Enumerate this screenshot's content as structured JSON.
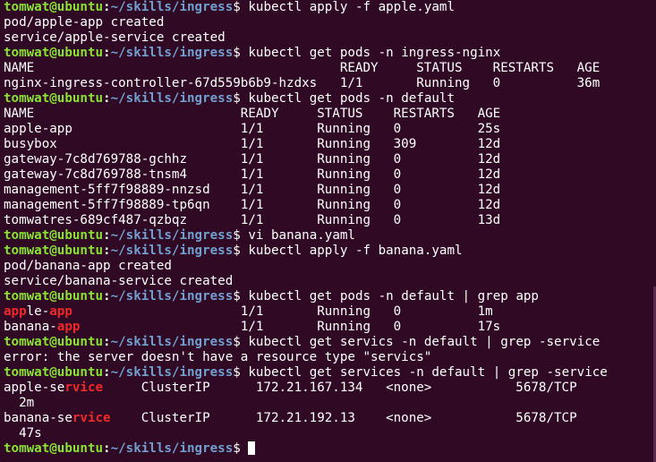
{
  "prompt": {
    "user": "tomwat@ubuntu",
    "sep": ":",
    "path": "~/skills/ingress",
    "dollar": "$ "
  },
  "lines": [
    {
      "type": "prompt",
      "cmd": "kubectl apply -f apple.yaml"
    },
    {
      "type": "out",
      "text": "pod/apple-app created"
    },
    {
      "type": "out",
      "text": "service/apple-service created"
    },
    {
      "type": "prompt",
      "cmd": "kubectl get pods -n ingress-nginx"
    },
    {
      "type": "out",
      "text": "NAME                                        READY     STATUS    RESTARTS   AGE"
    },
    {
      "type": "out",
      "text": "nginx-ingress-controller-67d559b6b9-hzdxs   1/1       Running   0          36m"
    },
    {
      "type": "prompt",
      "cmd": "kubectl get pods -n default"
    },
    {
      "type": "out",
      "text": "NAME                           READY     STATUS    RESTARTS   AGE"
    },
    {
      "type": "out",
      "text": "apple-app                      1/1       Running   0          25s"
    },
    {
      "type": "out",
      "text": "busybox                        1/1       Running   309        12d"
    },
    {
      "type": "out",
      "text": "gateway-7c8d769788-gchhz       1/1       Running   0          12d"
    },
    {
      "type": "out",
      "text": "gateway-7c8d769788-tnsm4       1/1       Running   0          12d"
    },
    {
      "type": "out",
      "text": "management-5ff7f98889-nnzsd    1/1       Running   0          12d"
    },
    {
      "type": "out",
      "text": "management-5ff7f98889-tp6qn    1/1       Running   0          12d"
    },
    {
      "type": "out",
      "text": "tomwatres-689cf487-qzbqz       1/1       Running   0          13d"
    },
    {
      "type": "prompt",
      "cmd": "vi banana.yaml"
    },
    {
      "type": "prompt",
      "cmd": "kubectl apply -f banana.yaml"
    },
    {
      "type": "out",
      "text": "pod/banana-app created"
    },
    {
      "type": "out",
      "text": "service/banana-service created"
    },
    {
      "type": "prompt",
      "cmd": "kubectl get pods -n default | grep app"
    },
    {
      "type": "hl",
      "pre": "",
      "hl": "app",
      "post": "le-",
      "hl2": "app",
      "rest": "                      1/1       Running   0          1m"
    },
    {
      "type": "hl",
      "pre": "banana-",
      "hl": "app",
      "post": "",
      "hl2": "",
      "rest": "                     1/1       Running   0          17s"
    },
    {
      "type": "prompt",
      "cmd": "kubectl get servics -n default | grep -service"
    },
    {
      "type": "out",
      "text": "error: the server doesn't have a resource type \"servics\""
    },
    {
      "type": "prompt",
      "cmd": "kubectl get services -n default | grep -service"
    },
    {
      "type": "hl",
      "pre": "apple-se",
      "hl": "rvice",
      "post": "",
      "hl2": "",
      "rest": "     ClusterIP      172.21.167.134   <none>           5678/TCP"
    },
    {
      "type": "out",
      "text": "  2m"
    },
    {
      "type": "hl",
      "pre": "banana-se",
      "hl": "rvice",
      "post": "",
      "hl2": "",
      "rest": "    ClusterIP      172.21.192.13    <none>           5678/TCP"
    },
    {
      "type": "out",
      "text": "  47s"
    },
    {
      "type": "prompt",
      "cmd": "",
      "cursor": true
    }
  ]
}
